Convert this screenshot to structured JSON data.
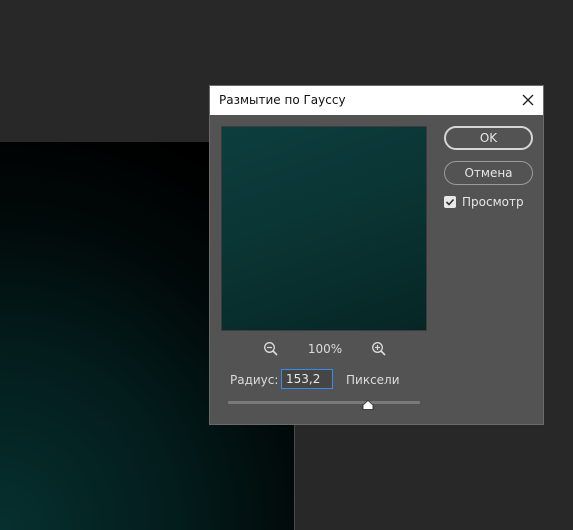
{
  "dialog": {
    "title": "Размытие по Гауссу",
    "zoom_level": "100%",
    "radius_label": "Радиус:",
    "radius_value": "153,2",
    "unit_label": "Пиксели",
    "slider_level": 0.73,
    "ok_label": "OK",
    "cancel_label": "Отмена",
    "preview_label": "Просмотр",
    "preview_checked": true
  },
  "icons": {
    "close": "close-icon",
    "zoom_out": "zoom-out-icon",
    "zoom_in": "zoom-in-icon",
    "checkmark": "checkmark-icon",
    "slider_thumb": "slider-thumb-icon"
  },
  "colors": {
    "workspace": "#282828",
    "dialog": "#535353",
    "input_focus": "#3a8be8"
  }
}
